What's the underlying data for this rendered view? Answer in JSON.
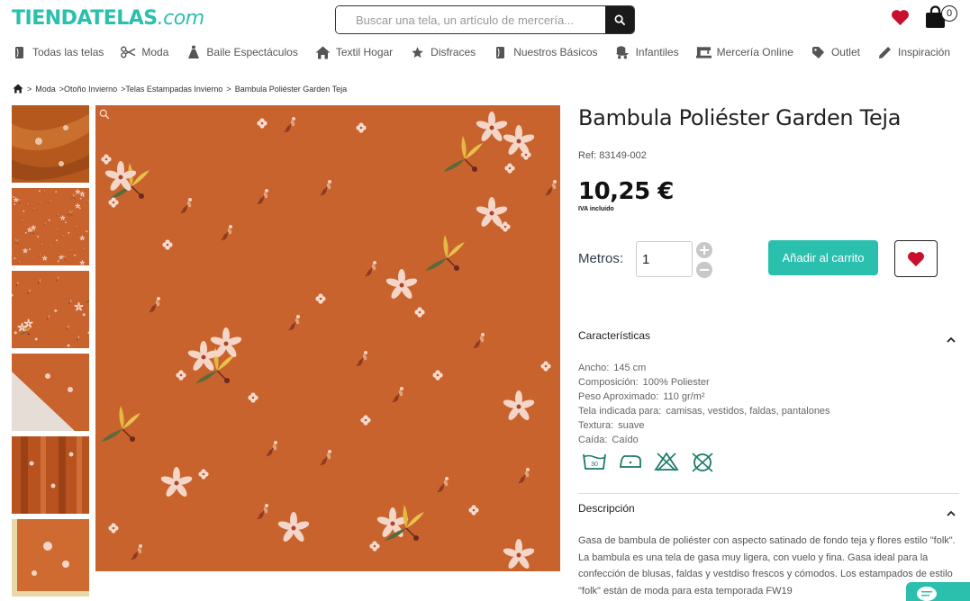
{
  "header": {
    "logo_main": "TIENDATELAS",
    "logo_suffix": ".com",
    "search_placeholder": "Buscar una tela, un artículo de mercería...",
    "cart_count": "0"
  },
  "nav": [
    {
      "label": "Todas las telas",
      "icon": "fabric-roll-icon"
    },
    {
      "label": "Moda",
      "icon": "scissors-icon"
    },
    {
      "label": "Baile Espectáculos",
      "icon": "dancer-icon"
    },
    {
      "label": "Textil Hogar",
      "icon": "home-icon"
    },
    {
      "label": "Disfraces",
      "icon": "star-icon"
    },
    {
      "label": "Nuestros Básicos",
      "icon": "fabric-roll-icon"
    },
    {
      "label": "Infantiles",
      "icon": "stroller-icon"
    },
    {
      "label": "Mercería Online",
      "icon": "sewing-machine-icon"
    },
    {
      "label": "Outlet",
      "icon": "tag-icon"
    },
    {
      "label": "Inspiración",
      "icon": "pencil-icon"
    }
  ],
  "breadcrumb": [
    "Moda",
    "Otoño Invierno",
    "Telas Estampadas Invierno",
    "Bambula Poliéster Garden Teja"
  ],
  "product": {
    "title": "Bambula Poliéster Garden Teja",
    "ref": "Ref: 83149-002",
    "price": "10,25 €",
    "tax_note": "IVA incluido",
    "qty_label": "Metros:",
    "qty_value": "1",
    "add_to_cart": "Añadir al carrito"
  },
  "characteristics": {
    "title": "Características",
    "rows": [
      {
        "label": "Ancho:",
        "value": "145 cm"
      },
      {
        "label": "Composición:",
        "value": "100% Poliester"
      },
      {
        "label": "Peso Aproximado:",
        "value": "110 gr/m²"
      },
      {
        "label": "Tela indicada para:",
        "value": "camisas, vestidos, faldas, pantalones"
      },
      {
        "label": "Textura:",
        "value": "suave"
      },
      {
        "label": "Caída:",
        "value": "Caído"
      }
    ],
    "care_icons": [
      "wash-30-icon",
      "iron-low-icon",
      "no-bleach-icon",
      "no-tumble-dry-icon"
    ],
    "wash_temp": "30"
  },
  "description": {
    "title": "Descripción",
    "text": "Gasa de bambula de poliéster con aspecto satinado de fondo teja y flores estilo \"folk\". La bambula es una tela de gasa muy ligera, con vuelo y fina. Gasa ideal para la confección de blusas, faldas y vestdiso frescos y cómodos. Los estampados de estilo \"folk\" están de moda para esta temporada FW19"
  },
  "colors": {
    "brand": "#2bbfae",
    "fabric": "#c8632e",
    "heart": "#c8102e"
  }
}
